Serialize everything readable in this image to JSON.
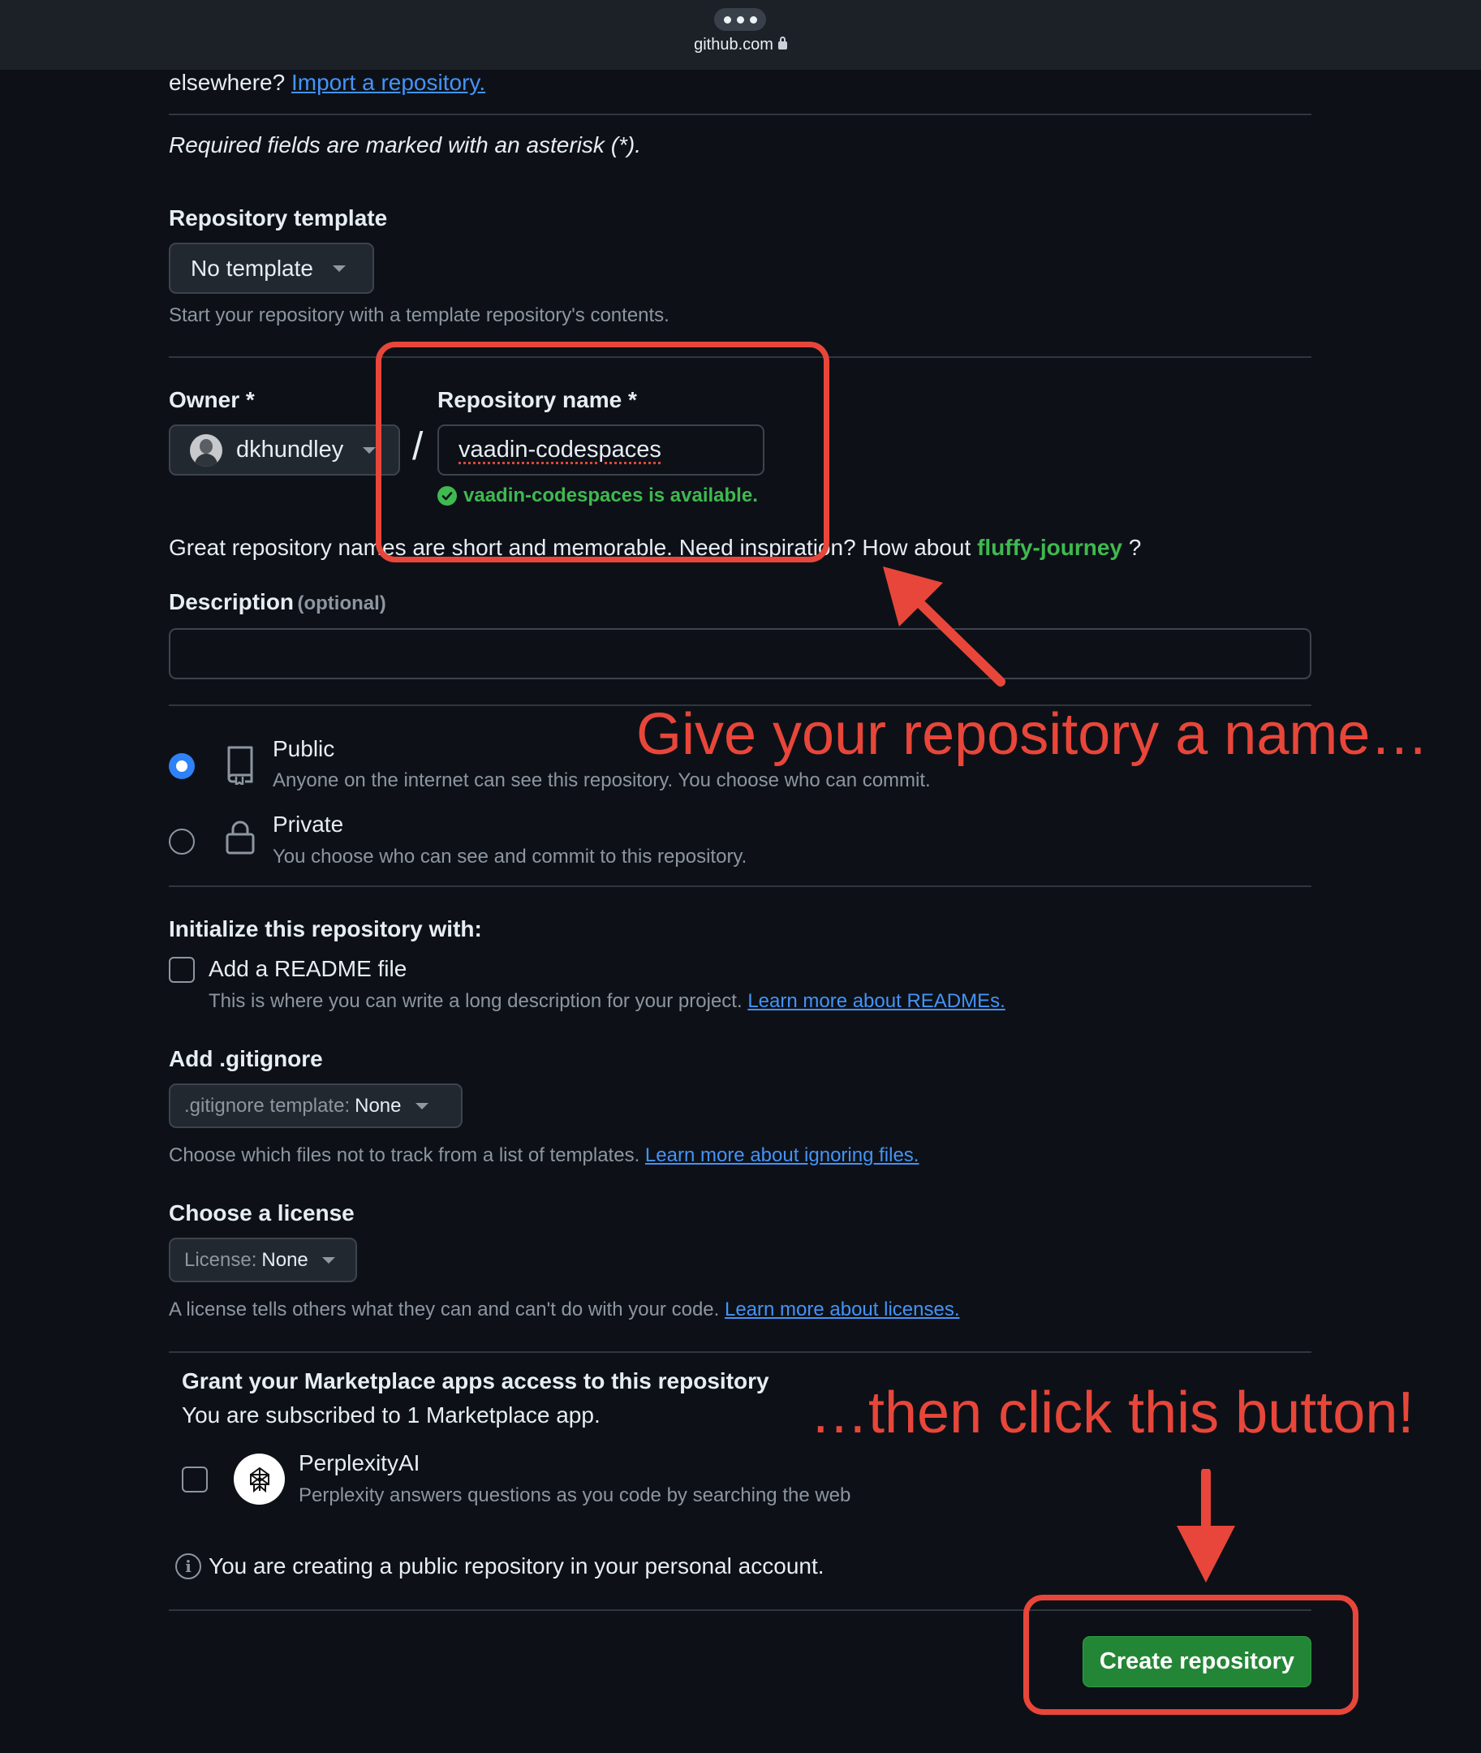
{
  "browser": {
    "url": "github.com"
  },
  "intro": {
    "prefix": "elsewhere? ",
    "import_link": "Import a repository.",
    "required_note": "Required fields are marked with an asterisk (*)."
  },
  "template": {
    "label": "Repository template",
    "value": "No template",
    "help": "Start your repository with a template repository's contents."
  },
  "owner": {
    "label": "Owner *",
    "value": "dkhundley",
    "separator": "/"
  },
  "repo_name": {
    "label": "Repository name *",
    "value": "vaadin-codespaces",
    "availability": "vaadin-codespaces is available."
  },
  "inspiration": {
    "text": "Great repository names are short and memorable. Need inspiration? How about ",
    "suggestion": "fluffy-journey",
    "suffix": " ?"
  },
  "description": {
    "label": "Description",
    "optional": "(optional)",
    "value": ""
  },
  "visibility": {
    "public": {
      "title": "Public",
      "desc": "Anyone on the internet can see this repository. You choose who can commit.",
      "selected": true
    },
    "private": {
      "title": "Private",
      "desc": "You choose who can see and commit to this repository.",
      "selected": false
    }
  },
  "initialize": {
    "label": "Initialize this repository with:",
    "readme_title": "Add a README file",
    "readme_desc": "This is where you can write a long description for your project. ",
    "readme_link": "Learn more about READMEs."
  },
  "gitignore": {
    "label": "Add .gitignore",
    "button_prefix": ".gitignore template: ",
    "button_value": "None",
    "help": "Choose which files not to track from a list of templates. ",
    "link": "Learn more about ignoring files."
  },
  "license": {
    "label": "Choose a license",
    "button_prefix": "License: ",
    "button_value": "None",
    "help": "A license tells others what they can and can't do with your code. ",
    "link": "Learn more about licenses."
  },
  "marketplace": {
    "title": "Grant your Marketplace apps access to this repository",
    "subtitle": "You are subscribed to 1 Marketplace app.",
    "app_name": "PerplexityAI",
    "app_desc": "Perplexity answers questions as you code by searching the web"
  },
  "info_note": "You are creating a public repository in your personal account.",
  "create_button": "Create repository",
  "annotations": {
    "name_hint": "Give your repository a name…",
    "button_hint": "…then click this button!",
    "color": "#e8463a"
  }
}
